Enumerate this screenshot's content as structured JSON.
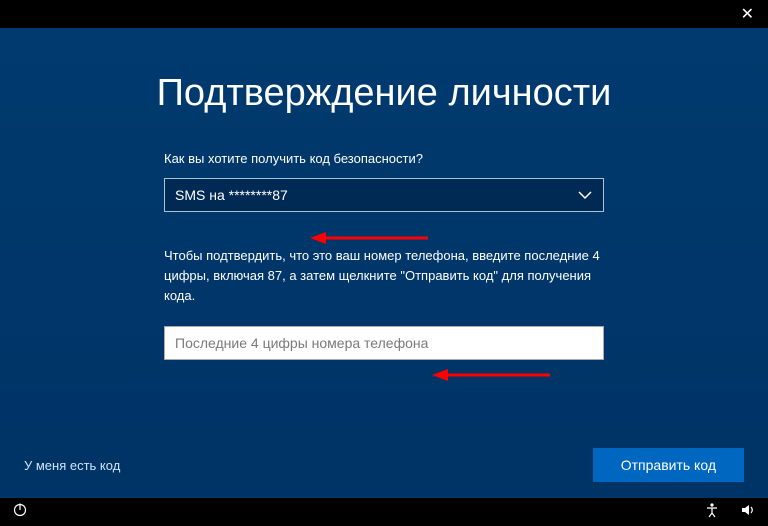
{
  "topbar": {
    "close": "✕"
  },
  "title": "Подтверждение личности",
  "question": "Как вы хотите получить код безопасности?",
  "select": {
    "value": "SMS на ********87"
  },
  "explain": "Чтобы подтвердить, что это ваш номер телефона, введите последние 4 цифры, включая 87, а затем щелкните \"Отправить код\" для получения кода.",
  "input": {
    "placeholder": "Последние 4 цифры номера телефона",
    "value": ""
  },
  "footer": {
    "link": "У меня есть код",
    "button": "Отправить код"
  },
  "colors": {
    "accent": "#0067c0",
    "background": "#003a6e",
    "arrow": "#ff0000"
  }
}
